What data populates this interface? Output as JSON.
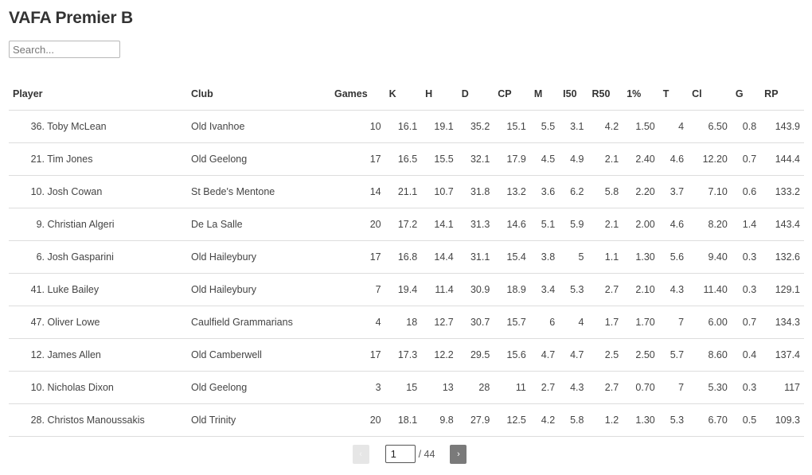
{
  "title": "VAFA Premier B",
  "search": {
    "placeholder": "Search...",
    "value": ""
  },
  "table": {
    "columns": [
      "Player",
      "Club",
      "Games",
      "K",
      "H",
      "D",
      "CP",
      "M",
      "I50",
      "R50",
      "1%",
      "T",
      "Cl",
      "G",
      "RP"
    ],
    "rows": [
      {
        "rank": "36.",
        "name": "Toby McLean",
        "club": "Old Ivanhoe",
        "stats": [
          "10",
          "16.1",
          "19.1",
          "35.2",
          "15.1",
          "5.5",
          "3.1",
          "4.2",
          "1.50",
          "4",
          "6.50",
          "0.8",
          "143.9"
        ]
      },
      {
        "rank": "21.",
        "name": "Tim Jones",
        "club": "Old Geelong",
        "stats": [
          "17",
          "16.5",
          "15.5",
          "32.1",
          "17.9",
          "4.5",
          "4.9",
          "2.1",
          "2.40",
          "4.6",
          "12.20",
          "0.7",
          "144.4"
        ]
      },
      {
        "rank": "10.",
        "name": "Josh Cowan",
        "club": "St Bede's Mentone",
        "stats": [
          "14",
          "21.1",
          "10.7",
          "31.8",
          "13.2",
          "3.6",
          "6.2",
          "5.8",
          "2.20",
          "3.7",
          "7.10",
          "0.6",
          "133.2"
        ]
      },
      {
        "rank": "9.",
        "name": "Christian Algeri",
        "club": "De La Salle",
        "stats": [
          "20",
          "17.2",
          "14.1",
          "31.3",
          "14.6",
          "5.1",
          "5.9",
          "2.1",
          "2.00",
          "4.6",
          "8.20",
          "1.4",
          "143.4"
        ]
      },
      {
        "rank": "6.",
        "name": "Josh Gasparini",
        "club": "Old Haileybury",
        "stats": [
          "17",
          "16.8",
          "14.4",
          "31.1",
          "15.4",
          "3.8",
          "5",
          "1.1",
          "1.30",
          "5.6",
          "9.40",
          "0.3",
          "132.6"
        ]
      },
      {
        "rank": "41.",
        "name": "Luke Bailey",
        "club": "Old Haileybury",
        "stats": [
          "7",
          "19.4",
          "11.4",
          "30.9",
          "18.9",
          "3.4",
          "5.3",
          "2.7",
          "2.10",
          "4.3",
          "11.40",
          "0.3",
          "129.1"
        ]
      },
      {
        "rank": "47.",
        "name": "Oliver Lowe",
        "club": "Caulfield Grammarians",
        "stats": [
          "4",
          "18",
          "12.7",
          "30.7",
          "15.7",
          "6",
          "4",
          "1.7",
          "1.70",
          "7",
          "6.00",
          "0.7",
          "134.3"
        ]
      },
      {
        "rank": "12.",
        "name": "James Allen",
        "club": "Old Camberwell",
        "stats": [
          "17",
          "17.3",
          "12.2",
          "29.5",
          "15.6",
          "4.7",
          "4.7",
          "2.5",
          "2.50",
          "5.7",
          "8.60",
          "0.4",
          "137.4"
        ]
      },
      {
        "rank": "10.",
        "name": "Nicholas Dixon",
        "club": "Old Geelong",
        "stats": [
          "3",
          "15",
          "13",
          "28",
          "11",
          "2.7",
          "4.3",
          "2.7",
          "0.70",
          "7",
          "5.30",
          "0.3",
          "117"
        ]
      },
      {
        "rank": "28.",
        "name": "Christos Manoussakis",
        "club": "Old Trinity",
        "stats": [
          "20",
          "18.1",
          "9.8",
          "27.9",
          "12.5",
          "4.2",
          "5.8",
          "1.2",
          "1.30",
          "5.3",
          "6.70",
          "0.5",
          "109.3"
        ]
      }
    ]
  },
  "pagination": {
    "prev_icon": "‹",
    "next_icon": "›",
    "current_page": "1",
    "total_label": "/ 44"
  }
}
